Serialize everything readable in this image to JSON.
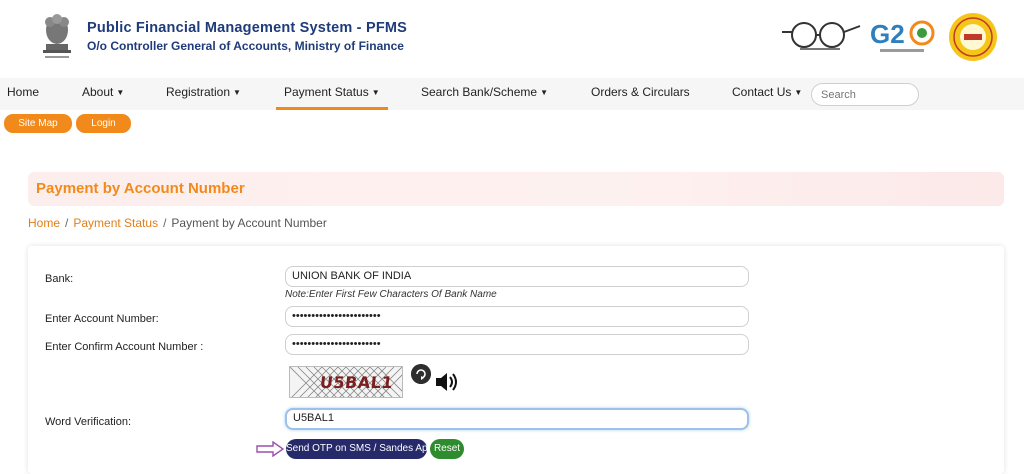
{
  "header": {
    "title": "Public Financial Management System - PFMS",
    "subtitle": "O/o Controller General of Accounts, Ministry of Finance",
    "logos": [
      "emblem-icon",
      "swachh-bharat-logo",
      "g20-logo",
      "pfms-logo"
    ]
  },
  "nav": {
    "items": [
      {
        "label": "Home",
        "dropdown": false
      },
      {
        "label": "About",
        "dropdown": true
      },
      {
        "label": "Registration",
        "dropdown": true
      },
      {
        "label": "Payment Status",
        "dropdown": true,
        "active": true
      },
      {
        "label": "Search Bank/Scheme",
        "dropdown": true
      },
      {
        "label": "Orders & Circulars",
        "dropdown": false
      },
      {
        "label": "Contact Us",
        "dropdown": true
      }
    ],
    "search_placeholder": "Search"
  },
  "quick_links": {
    "site_map": "Site Map",
    "login": "Login"
  },
  "page": {
    "title": "Payment by Account Number",
    "breadcrumb": [
      "Home",
      "Payment Status",
      "Payment by Account Number"
    ]
  },
  "form": {
    "bank_label": "Bank:",
    "bank_value": "UNION BANK OF INDIA",
    "bank_note": "Note:Enter First Few Characters Of Bank Name",
    "account_label": "Enter Account Number:",
    "account_value": "•••••••••••••••••••••••",
    "confirm_label": "Enter Confirm Account Number :",
    "confirm_value": "•••••••••••••••••••••••",
    "captcha_text": "U5BAL1",
    "word_label": "Word Verification:",
    "word_value": "U5BAL1",
    "send_otp_label": "Send OTP on SMS / Sandes App",
    "reset_label": "Reset"
  },
  "colors": {
    "accent": "#f28a1b",
    "title_blue": "#1f3b7a",
    "otp_button": "#262a6b",
    "reset_button": "#2e8b2e",
    "annotation_arrow": "#9b4fb0"
  }
}
